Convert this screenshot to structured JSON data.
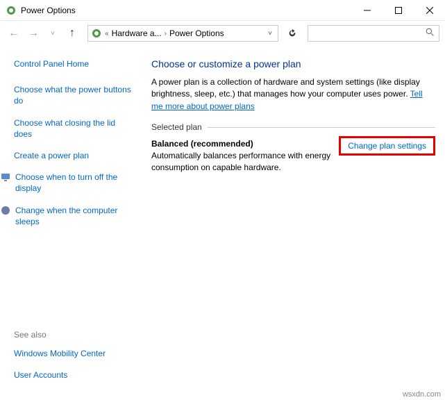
{
  "window": {
    "title": "Power Options"
  },
  "breadcrumb": {
    "item1": "Hardware a...",
    "item2": "Power Options"
  },
  "sidebar": {
    "home": "Control Panel Home",
    "links": [
      "Choose what the power buttons do",
      "Choose what closing the lid does",
      "Create a power plan",
      "Choose when to turn off the display",
      "Change when the computer sleeps"
    ],
    "see_also_label": "See also",
    "see_also": [
      "Windows Mobility Center",
      "User Accounts"
    ]
  },
  "main": {
    "heading": "Choose or customize a power plan",
    "description_pre": "A power plan is a collection of hardware and system settings (like display brightness, sleep, etc.) that manages how your computer uses power. ",
    "description_link": "Tell me more about power plans",
    "section_label": "Selected plan",
    "plan_name": "Balanced (recommended)",
    "plan_desc": "Automatically balances performance with energy consumption on capable hardware.",
    "change_link": "Change plan settings"
  },
  "watermark": "wsxdn.com"
}
